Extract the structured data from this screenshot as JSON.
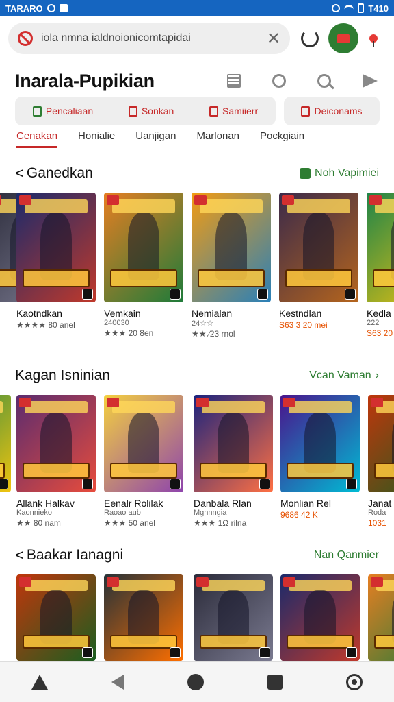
{
  "status_bar": {
    "left_text": "TARARO",
    "time": "T410"
  },
  "search": {
    "text": "iola nmna ialdnoionicomtapidai"
  },
  "header": {
    "title": "Inarala-Pupikian"
  },
  "chips": {
    "group": [
      "Pencaliaan",
      "Sonkan",
      "Samiierr"
    ],
    "solo": "Deiconams"
  },
  "tabs": [
    "Cenakan",
    "Honialie",
    "Uanjigan",
    "Marlonan",
    "Pockgiain"
  ],
  "sections": [
    {
      "title": "Ganedkan",
      "more": "Noh Vapimiei",
      "items": [
        {
          "name": "",
          "rating": ""
        },
        {
          "name": "Kaotndkan",
          "rating": "★★★★ 80 anel",
          "stars": "★★★★"
        },
        {
          "name": "Vemkain",
          "sub": "240030",
          "rating": "★★★ 20 8en",
          "stars": "★★★"
        },
        {
          "name": "Nemialan",
          "sub": "24☆☆",
          "rating": "★★ ⁄23 rnol",
          "stars": "★★"
        },
        {
          "name": "Kestndlan",
          "rating": "S63 3 20 mei",
          "stars": "★★★★"
        },
        {
          "name": "Kedla",
          "sub": "222",
          "rating": "S63 20",
          "stars": ""
        }
      ]
    },
    {
      "title": "Kagan Isninian",
      "more": "Vcan Vaman",
      "items": [
        {
          "name": "",
          "rating": ""
        },
        {
          "name": "Allank Halkav",
          "sub": "Kaonnieko",
          "rating": "★★ 80 nam",
          "stars": "★★"
        },
        {
          "name": "Eenalr Rolilak",
          "sub": "Raoao aub",
          "rating": "★★★ 50 anel",
          "stars": "★★★"
        },
        {
          "name": "Danbala Rlan",
          "sub": "Mgnnngia",
          "rating": "★★★ 1Ω rilna",
          "stars": "★★★"
        },
        {
          "name": "Monlian Rel",
          "rating": "9686 42 K",
          "stars": ""
        },
        {
          "name": "Janat",
          "sub": "Roda",
          "rating": "1031",
          "stars": ""
        }
      ]
    },
    {
      "title": "Baakar Ianagni",
      "more": "Nan Qanmier",
      "items": []
    }
  ],
  "colors": {
    "status_bar": "#1565c0",
    "accent_red": "#c62828",
    "accent_green": "#2e7d32"
  },
  "icons": [
    "no-entry-icon",
    "clear-icon",
    "refresh-icon",
    "mail-icon",
    "pin-icon",
    "list-icon",
    "user-icon",
    "search-icon",
    "send-icon",
    "home-icon",
    "back-icon",
    "compass-icon",
    "square-icon",
    "ring-icon"
  ]
}
